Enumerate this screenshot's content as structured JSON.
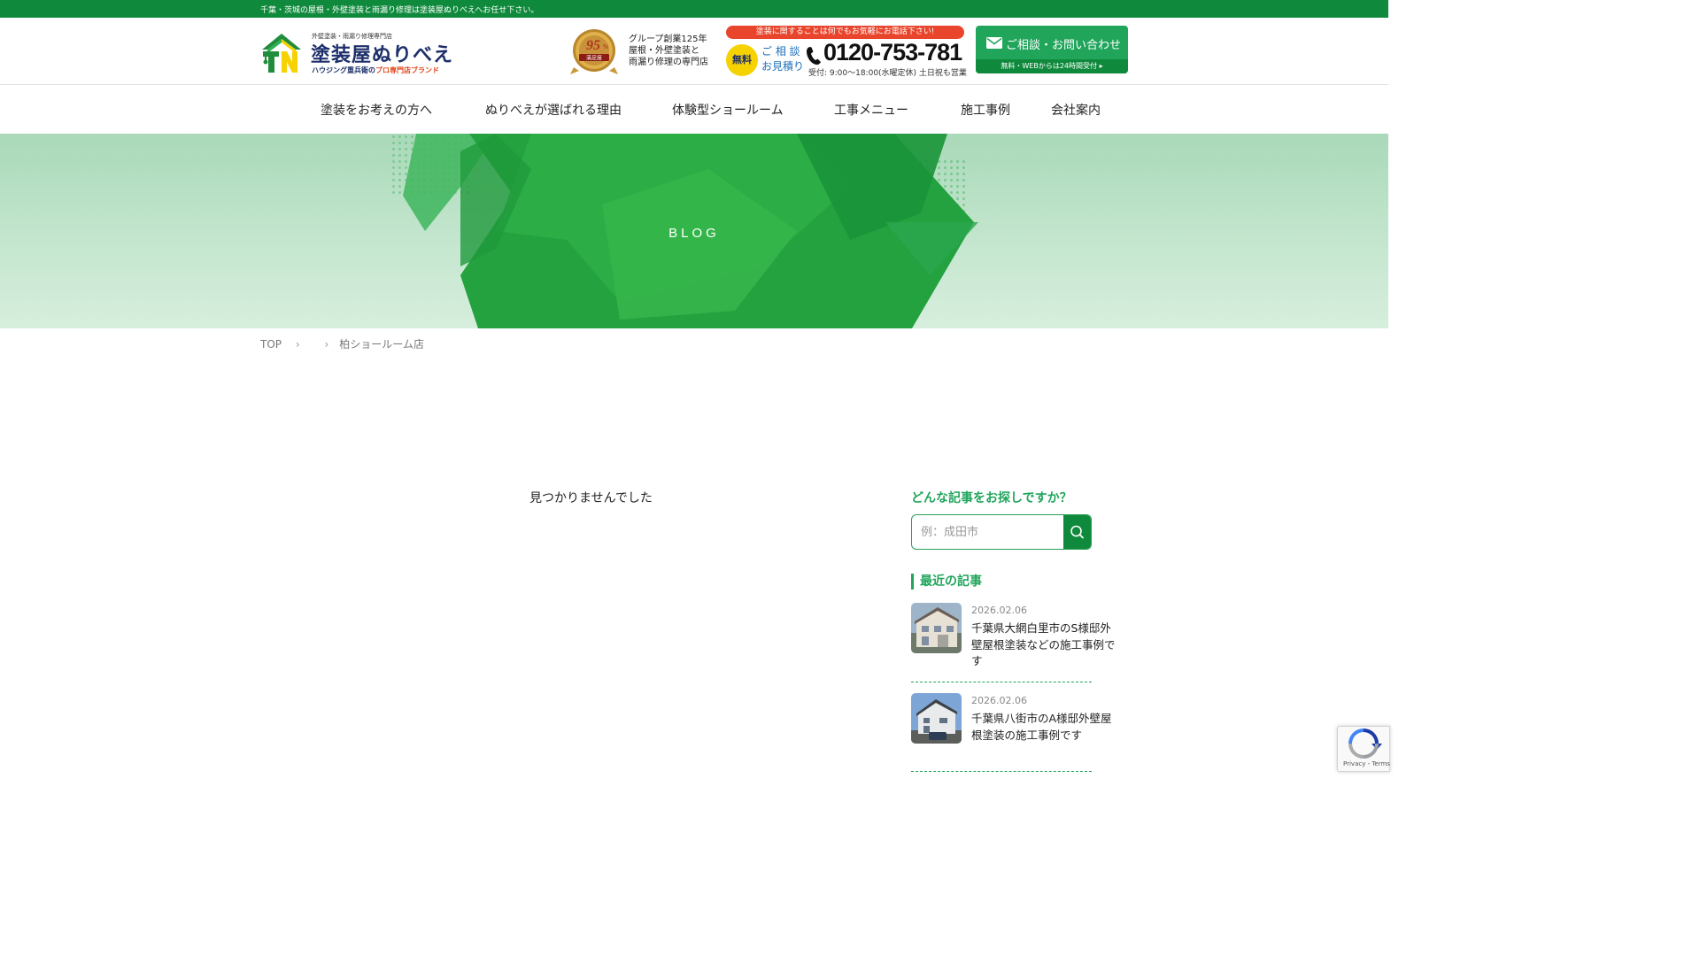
{
  "topbar": {
    "text": "千葉・茨城の屋根・外壁塗装と雨漏り修理は塗装屋ぬりべえへお任せ下さい。"
  },
  "logo": {
    "small": "外壁塗装・雨漏り修理専門店",
    "main": "塗装屋ぬりべえ",
    "sub_prefix": "ハウジング重兵衛の",
    "sub_accent": "プロ専門店ブランド"
  },
  "badge": {
    "text_line1": "グループ創業125年",
    "text_line2": "屋根・外壁塗装と",
    "text_line3": "雨漏り修理の専門店"
  },
  "tel": {
    "banner": "塗装に関することは何でもお気軽にお電話下さい!",
    "free": "無料",
    "side_line1": "ご 相 談",
    "side_line2": "お見積り",
    "number": "0120-753-781",
    "hours": "受付: 9:00〜18:00(水曜定休) 土日祝も営業"
  },
  "contact": {
    "label": "ご相談・お問い合わせ",
    "strip": "無料・WEBからは24時間受付 ▸"
  },
  "nav": {
    "items": [
      "塗装をお考えの方へ",
      "ぬりべえが選ばれる理由",
      "体験型ショールーム",
      "工事メニュー",
      "施工事例",
      "会社案内"
    ]
  },
  "hero": {
    "title": "BLOG"
  },
  "breadcrumb": {
    "top": "TOP",
    "current": "柏ショールーム店"
  },
  "main": {
    "not_found": "見つかりませんでした"
  },
  "sidebar": {
    "search_heading": "どんな記事をお探しですか？",
    "search_placeholder": "例：成田市",
    "recent_heading": "最近の記事",
    "posts": [
      {
        "date": "2026.02.06",
        "title": "千葉県大網白里市のS様邸外壁屋根塗装などの施工事例です"
      },
      {
        "date": "2026.02.06",
        "title": "千葉県八街市のA様邸外壁屋根塗装の施工事例です"
      }
    ]
  },
  "recaptcha": {
    "links": "Privacy - Terms"
  },
  "colors": {
    "brand_green": "#0f8a3c",
    "accent_green": "#20a55b",
    "navy": "#1d2f6b",
    "orange_red": "#e8452c",
    "yellow": "#f5d200"
  },
  "icons": [
    "logo-mark-icon",
    "satisfaction-badge-icon",
    "phone-icon",
    "mail-icon",
    "search-icon",
    "chevron-right-icon",
    "recaptcha-icon"
  ]
}
